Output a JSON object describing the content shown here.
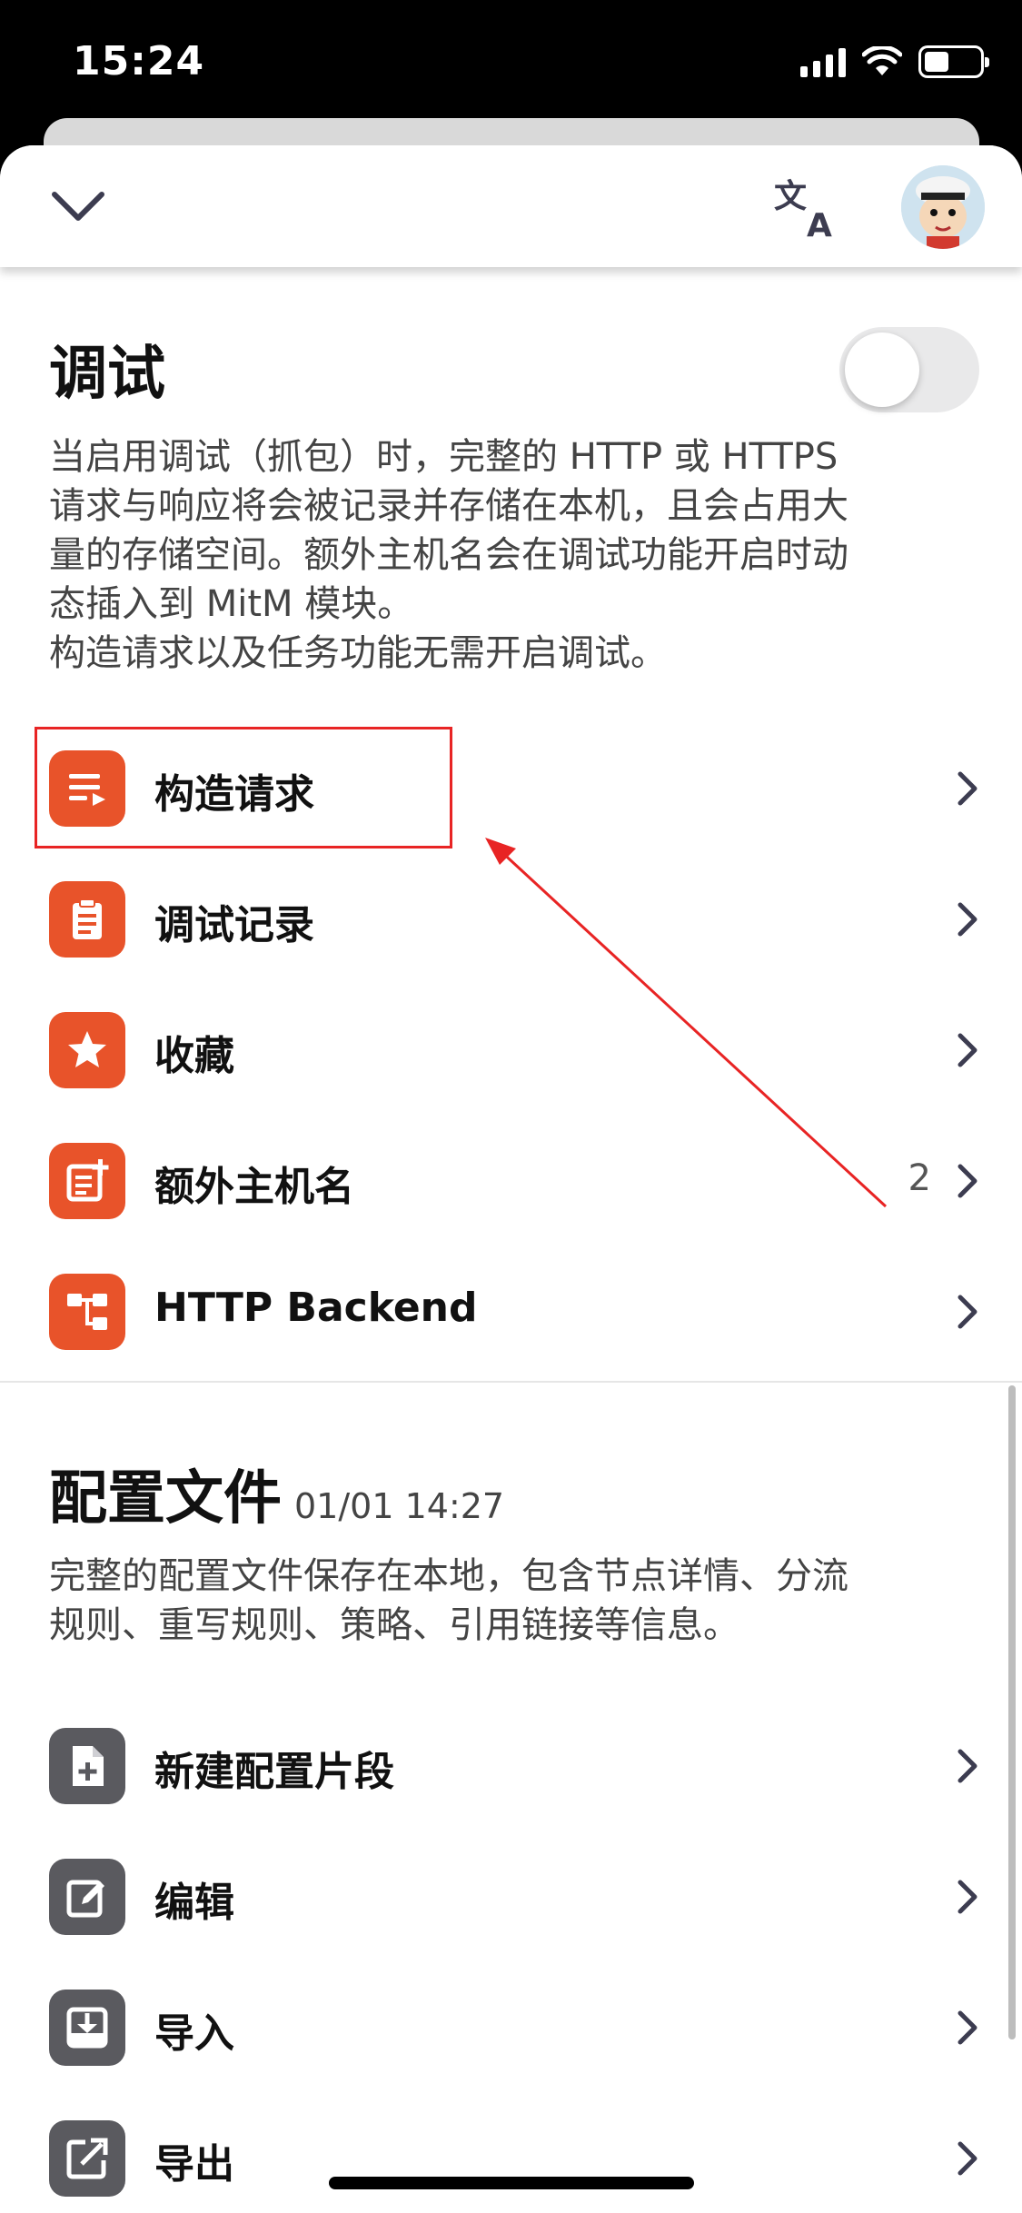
{
  "status_bar": {
    "time": "15:24"
  },
  "header": {
    "collapse_icon": "chevron-down-icon",
    "translate_icon": "translate-icon",
    "avatar": "user-avatar"
  },
  "debug": {
    "title": "调试",
    "toggle_on": false,
    "description_lines": [
      "当启用调试（抓包）时，完整的 HTTP 或 HTTPS",
      "请求与响应将会被记录并存储在本机，且会占用大",
      "量的存储空间。额外主机名会在调试功能开启时动",
      "态插入到 MitM 模块。",
      "构造请求以及任务功能无需开启调试。"
    ],
    "items": [
      {
        "label": "构造请求",
        "icon": "list-play-icon"
      },
      {
        "label": "调试记录",
        "icon": "clipboard-icon"
      },
      {
        "label": "收藏",
        "icon": "star-icon"
      },
      {
        "label": "额外主机名",
        "icon": "add-note-icon",
        "count": "2"
      },
      {
        "label": "HTTP Backend",
        "icon": "tree-icon"
      }
    ]
  },
  "profile": {
    "title": "配置文件",
    "timestamp": "01/01 14:27",
    "description_lines": [
      "完整的配置文件保存在本地，包含节点详情、分流",
      "规则、重写规则、策略、引用链接等信息。"
    ],
    "items": [
      {
        "label": "新建配置片段",
        "icon": "new-file-icon"
      },
      {
        "label": "编辑",
        "icon": "edit-icon"
      },
      {
        "label": "导入",
        "icon": "import-icon"
      },
      {
        "label": "导出",
        "icon": "export-icon"
      }
    ]
  },
  "colors": {
    "accent": "#e8532a",
    "gray_icon": "#5a5a5f",
    "annotation": "#e82424"
  }
}
